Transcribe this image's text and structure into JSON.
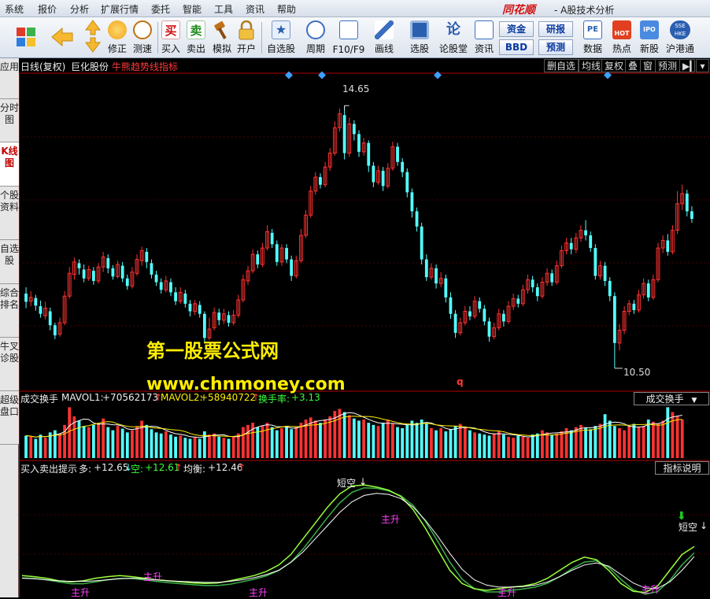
{
  "menu": {
    "items": [
      "系统",
      "报价",
      "分析",
      "扩展行情",
      "委托",
      "智能",
      "工具",
      "资讯",
      "帮助"
    ],
    "brand": "同花顺",
    "app_title": "- A股技术分析"
  },
  "toolbar": {
    "buttons": [
      {
        "label": "修正"
      },
      {
        "label": "测速"
      },
      {
        "label": "买入"
      },
      {
        "label": "卖出"
      },
      {
        "label": "模拟"
      },
      {
        "label": "开户"
      },
      {
        "label": "自选股"
      },
      {
        "label": "周期"
      },
      {
        "label": "F10/F9"
      },
      {
        "label": "画线"
      },
      {
        "label": "选股"
      },
      {
        "label": "论股堂"
      },
      {
        "label": "资讯"
      },
      {
        "label": "数据"
      },
      {
        "label": "热点"
      },
      {
        "label": "新股"
      },
      {
        "label": "沪港通"
      }
    ],
    "small_buttons": {
      "zijin": "资金",
      "yanbao": "研报",
      "bbd": "BBD",
      "yuce": "预测"
    },
    "icon_text": {
      "buy": "买",
      "sell": "卖",
      "lungutang": "论",
      "pe": "PE",
      "hot": "HOT",
      "ipo": "IPO",
      "sse": "SSE HKE"
    }
  },
  "leftnav": {
    "tabs": [
      "应用",
      "分时图",
      "K线图",
      "个股资料",
      "自选股",
      "综合排名",
      "牛叉诊股",
      "超级盘口"
    ],
    "active_index": 2
  },
  "main_chart": {
    "period": "日线(复权)",
    "stock_name": "巨化股份",
    "indicator": "牛熊趋势线指标",
    "toolbar": [
      "删自选",
      "均线",
      "复权",
      "叠",
      "窗",
      "预测"
    ],
    "high_label": "14.65",
    "low_label": "10.50",
    "marker_q": "q"
  },
  "volume_panel": {
    "title": "成交换手",
    "mavol1_label": "MAVOL1:",
    "mavol1_value": "+70562173",
    "mavol2_label": "MAVOL2:",
    "mavol2_value": "+58940722",
    "turnover_label": "换手率:",
    "turnover_value": "+3.13",
    "button": "成交换手"
  },
  "signal_panel": {
    "title": "买入卖出提示",
    "long_label": "多:",
    "long_value": "+12.65",
    "short_label": "空:",
    "short_value": "+12.61",
    "balance_label": "均衡:",
    "balance_value": "+12.46",
    "button": "指标说明",
    "short_signal": "短空",
    "rise_signal": "主升"
  },
  "watermark": {
    "line1": "第一股票公式网",
    "line2": "www.chnmoney.com"
  },
  "colors": {
    "up": "#ff3232",
    "down": "#54ffff",
    "ma_white": "#ffffff",
    "line_green": "#9aff3c",
    "signal_magenta": "#ff40ff",
    "watermark": "#ffee00",
    "diamond": "#3aa0ff"
  },
  "chart_data": {
    "type": "candlestick",
    "price_range": [
      10.2,
      15.1
    ],
    "candles": [
      {
        "o": 11.68,
        "c": 11.55,
        "h": 11.78,
        "l": 11.45
      },
      {
        "o": 11.56,
        "c": 11.62,
        "h": 11.72,
        "l": 11.48
      },
      {
        "o": 11.61,
        "c": 11.49,
        "h": 11.66,
        "l": 11.41
      },
      {
        "o": 11.48,
        "c": 11.36,
        "h": 11.57,
        "l": 11.3
      },
      {
        "o": 11.33,
        "c": 11.45,
        "h": 11.55,
        "l": 11.27
      },
      {
        "o": 11.4,
        "c": 11.18,
        "h": 11.46,
        "l": 11.1
      },
      {
        "o": 11.18,
        "c": 11.02,
        "h": 11.22,
        "l": 10.96
      },
      {
        "o": 11.04,
        "c": 11.22,
        "h": 11.3,
        "l": 11.0
      },
      {
        "o": 11.22,
        "c": 11.64,
        "h": 11.72,
        "l": 11.18
      },
      {
        "o": 11.64,
        "c": 12.0,
        "h": 12.1,
        "l": 11.6
      },
      {
        "o": 11.98,
        "c": 12.18,
        "h": 12.25,
        "l": 11.9
      },
      {
        "o": 12.16,
        "c": 12.08,
        "h": 12.22,
        "l": 11.98
      },
      {
        "o": 12.06,
        "c": 11.92,
        "h": 12.14,
        "l": 11.86
      },
      {
        "o": 11.92,
        "c": 12.06,
        "h": 12.12,
        "l": 11.88
      },
      {
        "o": 12.04,
        "c": 11.88,
        "h": 12.1,
        "l": 11.82
      },
      {
        "o": 11.88,
        "c": 12.1,
        "h": 12.16,
        "l": 11.84
      },
      {
        "o": 12.1,
        "c": 12.26,
        "h": 12.34,
        "l": 12.02
      },
      {
        "o": 12.24,
        "c": 12.08,
        "h": 12.3,
        "l": 12.0
      },
      {
        "o": 12.08,
        "c": 11.95,
        "h": 12.13,
        "l": 11.9
      },
      {
        "o": 11.95,
        "c": 12.14,
        "h": 12.2,
        "l": 11.92
      },
      {
        "o": 12.12,
        "c": 11.92,
        "h": 12.18,
        "l": 11.86
      },
      {
        "o": 11.92,
        "c": 11.8,
        "h": 11.98,
        "l": 11.74
      },
      {
        "o": 11.8,
        "c": 12.02,
        "h": 12.1,
        "l": 11.76
      },
      {
        "o": 12.0,
        "c": 12.22,
        "h": 12.3,
        "l": 11.96
      },
      {
        "o": 12.2,
        "c": 12.36,
        "h": 12.42,
        "l": 12.12
      },
      {
        "o": 12.34,
        "c": 12.18,
        "h": 12.4,
        "l": 12.08
      },
      {
        "o": 12.16,
        "c": 11.98,
        "h": 12.22,
        "l": 11.92
      },
      {
        "o": 11.98,
        "c": 11.86,
        "h": 12.04,
        "l": 11.8
      },
      {
        "o": 11.86,
        "c": 11.74,
        "h": 11.92,
        "l": 11.68
      },
      {
        "o": 11.74,
        "c": 11.88,
        "h": 11.96,
        "l": 11.7
      },
      {
        "o": 11.86,
        "c": 11.7,
        "h": 11.92,
        "l": 11.64
      },
      {
        "o": 11.7,
        "c": 11.56,
        "h": 11.78,
        "l": 11.5
      },
      {
        "o": 11.56,
        "c": 11.7,
        "h": 11.78,
        "l": 11.52
      },
      {
        "o": 11.68,
        "c": 11.52,
        "h": 11.74,
        "l": 11.46
      },
      {
        "o": 11.52,
        "c": 11.4,
        "h": 11.58,
        "l": 11.32
      },
      {
        "o": 11.4,
        "c": 11.52,
        "h": 11.58,
        "l": 11.34
      },
      {
        "o": 11.5,
        "c": 11.36,
        "h": 11.56,
        "l": 11.3
      },
      {
        "o": 11.36,
        "c": 10.98,
        "h": 11.4,
        "l": 10.9
      },
      {
        "o": 10.98,
        "c": 11.12,
        "h": 11.3,
        "l": 10.94
      },
      {
        "o": 11.14,
        "c": 11.38,
        "h": 11.46,
        "l": 11.1
      },
      {
        "o": 11.38,
        "c": 11.26,
        "h": 11.44,
        "l": 11.18
      },
      {
        "o": 11.26,
        "c": 11.36,
        "h": 11.44,
        "l": 11.2
      },
      {
        "o": 11.34,
        "c": 11.22,
        "h": 11.4,
        "l": 11.16
      },
      {
        "o": 11.22,
        "c": 11.34,
        "h": 11.42,
        "l": 11.18
      },
      {
        "o": 11.34,
        "c": 11.58,
        "h": 11.66,
        "l": 11.3
      },
      {
        "o": 11.58,
        "c": 11.9,
        "h": 11.98,
        "l": 11.54
      },
      {
        "o": 11.88,
        "c": 12.04,
        "h": 12.12,
        "l": 11.82
      },
      {
        "o": 12.04,
        "c": 12.3,
        "h": 12.38,
        "l": 12.0
      },
      {
        "o": 12.3,
        "c": 12.14,
        "h": 12.36,
        "l": 12.08
      },
      {
        "o": 12.14,
        "c": 12.4,
        "h": 12.48,
        "l": 12.1
      },
      {
        "o": 12.4,
        "c": 12.66,
        "h": 12.76,
        "l": 12.36
      },
      {
        "o": 12.64,
        "c": 12.46,
        "h": 12.7,
        "l": 12.4
      },
      {
        "o": 12.46,
        "c": 12.18,
        "h": 12.52,
        "l": 12.12
      },
      {
        "o": 12.18,
        "c": 12.4,
        "h": 12.46,
        "l": 12.12
      },
      {
        "o": 12.4,
        "c": 12.22,
        "h": 12.46,
        "l": 12.16
      },
      {
        "o": 12.22,
        "c": 11.96,
        "h": 12.28,
        "l": 11.88
      },
      {
        "o": 11.96,
        "c": 12.2,
        "h": 12.28,
        "l": 11.92
      },
      {
        "o": 12.2,
        "c": 12.6,
        "h": 12.7,
        "l": 12.16
      },
      {
        "o": 12.6,
        "c": 12.92,
        "h": 13.0,
        "l": 12.56
      },
      {
        "o": 12.92,
        "c": 13.3,
        "h": 13.38,
        "l": 12.88
      },
      {
        "o": 13.3,
        "c": 13.52,
        "h": 13.6,
        "l": 13.24
      },
      {
        "o": 13.52,
        "c": 13.4,
        "h": 13.58,
        "l": 13.34
      },
      {
        "o": 13.4,
        "c": 13.68,
        "h": 13.76,
        "l": 13.36
      },
      {
        "o": 13.68,
        "c": 13.9,
        "h": 13.98,
        "l": 13.62
      },
      {
        "o": 13.9,
        "c": 14.3,
        "h": 14.4,
        "l": 13.86
      },
      {
        "o": 14.3,
        "c": 14.52,
        "h": 14.6,
        "l": 14.24
      },
      {
        "o": 14.5,
        "c": 13.9,
        "h": 14.65,
        "l": 13.8
      },
      {
        "o": 13.9,
        "c": 14.36,
        "h": 14.46,
        "l": 13.84
      },
      {
        "o": 14.36,
        "c": 14.2,
        "h": 14.42,
        "l": 14.1
      },
      {
        "o": 14.2,
        "c": 13.92,
        "h": 14.26,
        "l": 13.84
      },
      {
        "o": 13.92,
        "c": 14.06,
        "h": 14.14,
        "l": 13.86
      },
      {
        "o": 14.06,
        "c": 13.7,
        "h": 14.1,
        "l": 13.6
      },
      {
        "o": 13.7,
        "c": 13.44,
        "h": 13.76,
        "l": 13.36
      },
      {
        "o": 13.44,
        "c": 13.62,
        "h": 13.7,
        "l": 13.4
      },
      {
        "o": 13.62,
        "c": 13.38,
        "h": 13.68,
        "l": 13.3
      },
      {
        "o": 13.38,
        "c": 13.66,
        "h": 13.74,
        "l": 13.34
      },
      {
        "o": 13.66,
        "c": 14.0,
        "h": 14.08,
        "l": 13.62
      },
      {
        "o": 14.0,
        "c": 13.76,
        "h": 14.06,
        "l": 13.7
      },
      {
        "o": 13.76,
        "c": 13.6,
        "h": 13.82,
        "l": 13.52
      },
      {
        "o": 13.6,
        "c": 13.28,
        "h": 13.66,
        "l": 13.2
      },
      {
        "o": 13.28,
        "c": 12.98,
        "h": 13.34,
        "l": 12.88
      },
      {
        "o": 12.98,
        "c": 12.74,
        "h": 13.04,
        "l": 12.66
      },
      {
        "o": 12.74,
        "c": 12.22,
        "h": 12.8,
        "l": 12.14
      },
      {
        "o": 12.22,
        "c": 11.94,
        "h": 12.3,
        "l": 11.88
      },
      {
        "o": 11.94,
        "c": 12.08,
        "h": 12.16,
        "l": 11.9
      },
      {
        "o": 12.08,
        "c": 11.84,
        "h": 12.14,
        "l": 11.76
      },
      {
        "o": 11.84,
        "c": 11.92,
        "h": 12.02,
        "l": 11.78
      },
      {
        "o": 11.92,
        "c": 11.62,
        "h": 11.98,
        "l": 11.54
      },
      {
        "o": 11.62,
        "c": 11.36,
        "h": 11.7,
        "l": 11.28
      },
      {
        "o": 11.36,
        "c": 11.06,
        "h": 11.42,
        "l": 10.98
      },
      {
        "o": 11.06,
        "c": 11.22,
        "h": 11.3,
        "l": 11.02
      },
      {
        "o": 11.22,
        "c": 11.4,
        "h": 11.48,
        "l": 11.18
      },
      {
        "o": 11.4,
        "c": 11.32,
        "h": 11.48,
        "l": 11.26
      },
      {
        "o": 11.32,
        "c": 11.56,
        "h": 11.64,
        "l": 11.28
      },
      {
        "o": 11.56,
        "c": 11.44,
        "h": 11.62,
        "l": 11.38
      },
      {
        "o": 11.44,
        "c": 11.24,
        "h": 11.5,
        "l": 11.18
      },
      {
        "o": 11.24,
        "c": 11.0,
        "h": 11.3,
        "l": 10.92
      },
      {
        "o": 11.0,
        "c": 11.14,
        "h": 11.22,
        "l": 10.96
      },
      {
        "o": 11.14,
        "c": 11.36,
        "h": 11.44,
        "l": 11.1
      },
      {
        "o": 11.36,
        "c": 11.24,
        "h": 11.42,
        "l": 11.16
      },
      {
        "o": 11.24,
        "c": 11.48,
        "h": 11.56,
        "l": 11.2
      },
      {
        "o": 11.48,
        "c": 11.6,
        "h": 11.68,
        "l": 11.42
      },
      {
        "o": 11.6,
        "c": 11.52,
        "h": 11.66,
        "l": 11.46
      },
      {
        "o": 11.52,
        "c": 11.74,
        "h": 11.82,
        "l": 11.48
      },
      {
        "o": 11.74,
        "c": 11.9,
        "h": 11.98,
        "l": 11.68
      },
      {
        "o": 11.9,
        "c": 11.78,
        "h": 11.96,
        "l": 11.7
      },
      {
        "o": 11.78,
        "c": 11.64,
        "h": 11.84,
        "l": 11.56
      },
      {
        "o": 11.64,
        "c": 11.86,
        "h": 11.94,
        "l": 11.6
      },
      {
        "o": 11.86,
        "c": 12.0,
        "h": 12.08,
        "l": 11.8
      },
      {
        "o": 12.0,
        "c": 11.86,
        "h": 12.06,
        "l": 11.8
      },
      {
        "o": 11.86,
        "c": 12.12,
        "h": 12.2,
        "l": 11.82
      },
      {
        "o": 12.12,
        "c": 12.36,
        "h": 12.44,
        "l": 12.08
      },
      {
        "o": 12.36,
        "c": 12.48,
        "h": 12.56,
        "l": 12.3
      },
      {
        "o": 12.48,
        "c": 12.38,
        "h": 12.56,
        "l": 12.3
      },
      {
        "o": 12.38,
        "c": 12.56,
        "h": 12.64,
        "l": 12.32
      },
      {
        "o": 12.56,
        "c": 12.68,
        "h": 12.76,
        "l": 12.5
      },
      {
        "o": 12.68,
        "c": 12.6,
        "h": 12.84,
        "l": 12.52
      },
      {
        "o": 12.6,
        "c": 12.4,
        "h": 12.66,
        "l": 12.34
      },
      {
        "o": 12.4,
        "c": 11.96,
        "h": 12.46,
        "l": 11.9
      },
      {
        "o": 11.96,
        "c": 12.12,
        "h": 12.2,
        "l": 11.9
      },
      {
        "o": 12.12,
        "c": 11.88,
        "h": 12.18,
        "l": 11.8
      },
      {
        "o": 11.88,
        "c": 11.64,
        "h": 11.94,
        "l": 11.56
      },
      {
        "o": 11.64,
        "c": 10.9,
        "h": 11.7,
        "l": 10.5
      },
      {
        "o": 10.9,
        "c": 11.1,
        "h": 11.2,
        "l": 10.78
      },
      {
        "o": 11.1,
        "c": 11.4,
        "h": 11.48,
        "l": 11.04
      },
      {
        "o": 11.4,
        "c": 11.52,
        "h": 11.58,
        "l": 11.34
      },
      {
        "o": 11.52,
        "c": 11.42,
        "h": 11.58,
        "l": 11.36
      },
      {
        "o": 11.42,
        "c": 11.66,
        "h": 11.74,
        "l": 11.38
      },
      {
        "o": 11.66,
        "c": 11.84,
        "h": 11.92,
        "l": 11.6
      },
      {
        "o": 11.84,
        "c": 11.62,
        "h": 11.9,
        "l": 11.56
      },
      {
        "o": 11.62,
        "c": 11.9,
        "h": 11.98,
        "l": 11.58
      },
      {
        "o": 11.9,
        "c": 12.4,
        "h": 12.48,
        "l": 11.86
      },
      {
        "o": 12.4,
        "c": 12.52,
        "h": 12.6,
        "l": 12.32
      },
      {
        "o": 12.52,
        "c": 12.34,
        "h": 12.62,
        "l": 12.28
      },
      {
        "o": 12.34,
        "c": 12.68,
        "h": 12.76,
        "l": 12.3
      },
      {
        "o": 12.68,
        "c": 13.1,
        "h": 13.3,
        "l": 12.62
      },
      {
        "o": 13.1,
        "c": 13.26,
        "h": 13.4,
        "l": 13.0
      },
      {
        "o": 13.26,
        "c": 12.98,
        "h": 13.32,
        "l": 12.9
      },
      {
        "o": 12.98,
        "c": 12.86,
        "h": 13.06,
        "l": 12.8
      }
    ],
    "volume": [
      42,
      40,
      36,
      44,
      38,
      48,
      52,
      46,
      62,
      95,
      78,
      70,
      60,
      58,
      62,
      66,
      74,
      58,
      52,
      60,
      55,
      48,
      52,
      60,
      70,
      62,
      54,
      48,
      46,
      50,
      44,
      40,
      42,
      38,
      36,
      40,
      36,
      50,
      44,
      46,
      40,
      38,
      36,
      40,
      46,
      58,
      62,
      66,
      58,
      60,
      66,
      58,
      52,
      56,
      60,
      54,
      58,
      66,
      72,
      76,
      70,
      66,
      72,
      78,
      88,
      92,
      86,
      80,
      74,
      70,
      72,
      66,
      62,
      60,
      66,
      72,
      64,
      58,
      56,
      62,
      70,
      66,
      72,
      64,
      56,
      52,
      56,
      50,
      54,
      60,
      64,
      56,
      52,
      48,
      46,
      44,
      42,
      46,
      50,
      44,
      40,
      38,
      42,
      40,
      38,
      44,
      46,
      52,
      48,
      44,
      46,
      50,
      56,
      52,
      58,
      62,
      56,
      54,
      60,
      64,
      82,
      70,
      60,
      56,
      52,
      60,
      64,
      58,
      60,
      72,
      68,
      64,
      70,
      95,
      86,
      78,
      72
    ],
    "long_line": [
      12.1,
      12.08,
      12.05,
      12.0,
      11.98,
      12.0,
      12.05,
      12.08,
      12.1,
      12.08,
      12.05,
      12.02,
      12.0,
      11.98,
      11.96,
      11.95,
      11.96,
      12.0,
      12.05,
      12.1,
      12.18,
      12.3,
      12.5,
      12.8,
      13.1,
      13.4,
      13.65,
      13.8,
      13.82,
      13.78,
      13.72,
      13.6,
      13.35,
      13.0,
      12.6,
      12.2,
      11.95,
      11.85,
      11.82,
      11.85,
      11.88,
      11.9,
      11.95,
      12.05,
      12.2,
      12.35,
      12.45,
      12.4,
      12.2,
      11.95,
      11.8,
      11.78,
      11.9,
      12.2,
      12.5,
      12.65
    ],
    "balance_line": [
      12.05,
      12.04,
      12.02,
      12.0,
      11.99,
      11.99,
      12.0,
      12.02,
      12.04,
      12.05,
      12.04,
      12.02,
      12.0,
      11.99,
      11.98,
      11.97,
      11.97,
      11.99,
      12.02,
      12.06,
      12.12,
      12.2,
      12.35,
      12.55,
      12.8,
      13.05,
      13.3,
      13.5,
      13.62,
      13.66,
      13.64,
      13.56,
      13.4,
      13.15,
      12.85,
      12.52,
      12.22,
      12.02,
      11.92,
      11.88,
      11.88,
      11.89,
      11.92,
      11.98,
      12.08,
      12.2,
      12.3,
      12.34,
      12.28,
      12.12,
      11.96,
      11.86,
      11.86,
      11.98,
      12.2,
      12.46
    ]
  }
}
